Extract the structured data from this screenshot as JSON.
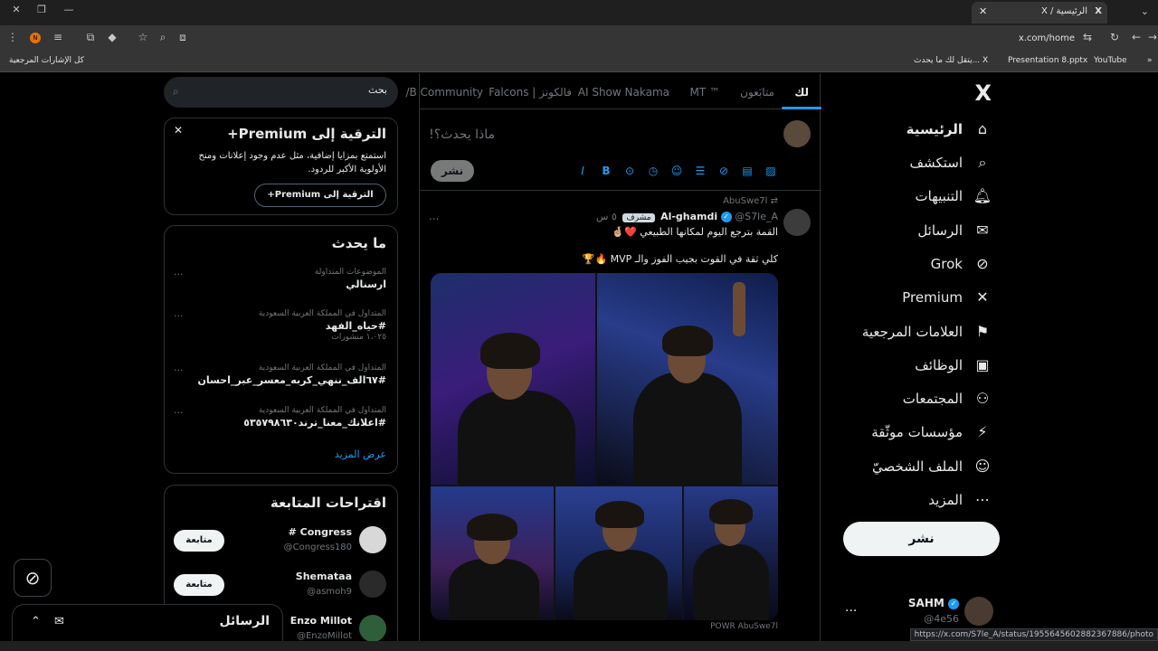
{
  "browser": {
    "tab_title": "الرئيسية / X",
    "url": "x.com/home",
    "profile_initial": "N",
    "bookmarks": [
      {
        "label": "يتقل لك ما يحدث... X"
      },
      {
        "label": "Presentation 8.pptx"
      },
      {
        "label": "YouTube"
      },
      {
        "label": "كل الإشارات المرجعية"
      }
    ],
    "status_url": "https://x.com/S7le_A/status/1955645602882367886/photo"
  },
  "nav": {
    "logo": "X",
    "items": [
      {
        "label": "الرئيسية",
        "icon": "home-icon",
        "glyph": "⌂"
      },
      {
        "label": "استكشف",
        "icon": "search-icon",
        "glyph": "⌕"
      },
      {
        "label": "التنبيهات",
        "icon": "bell-icon",
        "glyph": "🔔︎"
      },
      {
        "label": "الرسائل",
        "icon": "mail-icon",
        "glyph": "✉"
      },
      {
        "label": "Grok",
        "icon": "grok-icon",
        "glyph": "⊘"
      },
      {
        "label": "Premium",
        "icon": "x-icon",
        "glyph": "✕"
      },
      {
        "label": "العلامات المرجعية",
        "icon": "bookmark-icon",
        "glyph": "⚑"
      },
      {
        "label": "الوظائف",
        "icon": "briefcase-icon",
        "glyph": "▣"
      },
      {
        "label": "المجتمعات",
        "icon": "people-icon",
        "glyph": "⚇"
      },
      {
        "label": "مؤسسات موثّقة",
        "icon": "lightning-icon",
        "glyph": "⚡"
      },
      {
        "label": "الملف الشخصيّ",
        "icon": "person-icon",
        "glyph": "☺"
      },
      {
        "label": "المزيد",
        "icon": "more-circle-icon",
        "glyph": "⋯"
      }
    ],
    "post_button": "نشر",
    "account": {
      "name": "SAHM",
      "handle": "@4e56",
      "more": "..."
    }
  },
  "timeline": {
    "tabs": [
      "لك",
      "متابَعون",
      "MT ™",
      "AI Show Nakama",
      "Falcons | فالكونز",
      "/B Community"
    ],
    "compose_placeholder": "ماذا يحدث؟!",
    "compose_post": "نشر",
    "compose_icons": [
      "image-icon",
      "gif-icon",
      "grok-icon",
      "list-icon",
      "emoji-icon",
      "schedule-icon",
      "location-icon",
      "bold-icon",
      "italic-icon"
    ],
    "tweet": {
      "reposted_by": "AbuSwe7l",
      "name": "Al-ghamdi",
      "handle": "@S7le_A",
      "badge": "مشرف",
      "time": "٥ س",
      "more": "...",
      "line1": "القمة بترجع اليوم لمكانها الطبيعي ❤️🤞🏼",
      "line2": "كلي ثقة في القوت بجيب الفوز والـ MVP 🔥🏆",
      "media_caption": "POWR AbuSwe7l"
    }
  },
  "sidebar": {
    "search_placeholder": "بحث",
    "premium": {
      "title": "الترقية إلى Premium+",
      "description": "استمتع بمزايا إضافية، مثل عدم وجود إعلانات ومنح الأولوية الأكبر للردود.",
      "button": "الترقية إلى Premium+",
      "close": "✕"
    },
    "trends": {
      "title": "ما يحدث",
      "items": [
        {
          "context": "الموضوعات المتداولة",
          "name": "ارسنالي",
          "count": ""
        },
        {
          "context": "المتداول في المملكة العربية السعودية",
          "name": "#حياه_الفهد",
          "count": "١،٠٢٥ منشورات"
        },
        {
          "context": "المتداول في المملكة العربية السعودية",
          "name": "#٦٧الف_ننهي_كربه_معسر_عبر_احسان",
          "count": ""
        },
        {
          "context": "المتداول في المملكة العربية السعودية",
          "name": "#اعلانك_معنا_ترند٥٣٥٧٩٨٦٣٠",
          "count": ""
        }
      ],
      "more": "...",
      "show_more": "عرض المزيد"
    },
    "follow": {
      "title": "اقتراحات المتابعة",
      "users": [
        {
          "name": "# Congress",
          "handle": "@Congress180",
          "button": "متابعة",
          "color": "#d8d8d8"
        },
        {
          "name": "Shemataa",
          "handle": "@asmoh9",
          "button": "متابعة",
          "color": "#2a2a2a"
        },
        {
          "name": "Enzo Millot",
          "handle": "@EnzoMillot",
          "button": "متابعة",
          "color": "#2f5f3a"
        }
      ]
    }
  },
  "messages_drawer": {
    "title": "الرسائل"
  },
  "colors": {
    "accent": "#1d9bf0",
    "background": "#000000",
    "border": "#2f3336",
    "muted": "#71767b"
  }
}
